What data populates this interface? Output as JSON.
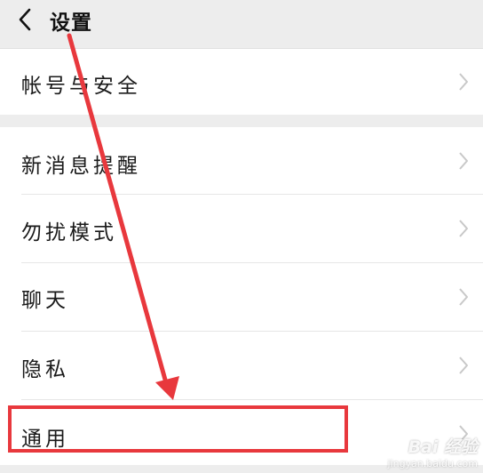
{
  "header": {
    "title": "设置",
    "back_icon": "chevron-left-icon"
  },
  "settings": {
    "account_security": "帐号与安全",
    "new_message_alert": "新消息提醒",
    "do_not_disturb": "勿扰模式",
    "chat": "聊天",
    "privacy": "隐私",
    "general": "通用"
  },
  "annotation": {
    "color": "#e8383d"
  },
  "watermark": {
    "main": "Bai  经验",
    "sub": "jingyan.baidu.com"
  },
  "colors": {
    "background": "#ededed",
    "row": "#ffffff",
    "chevron": "#c8c8c8"
  }
}
